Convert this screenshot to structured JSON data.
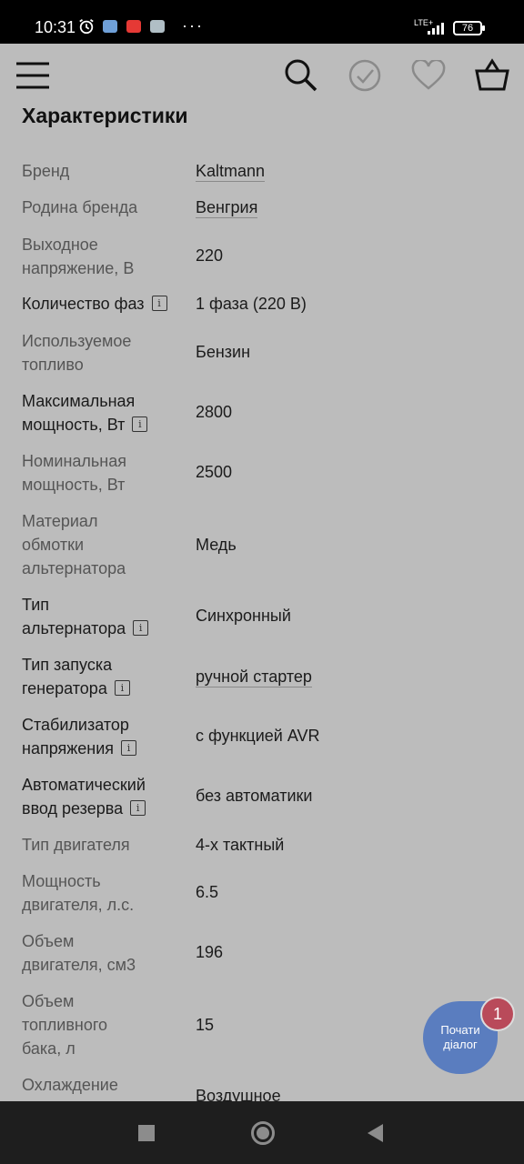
{
  "status_bar": {
    "time": "10:31",
    "more": "···",
    "network": "LTE+",
    "battery": "76"
  },
  "section": {
    "title": "Характеристики"
  },
  "specs": [
    {
      "label": "Бренд",
      "value": "Kaltmann",
      "link": true,
      "info": false
    },
    {
      "label": "Родина бренда",
      "value": "Венгрия",
      "link": true,
      "info": false
    },
    {
      "label": "Выходное напряжение, В",
      "value": "220",
      "link": false,
      "info": false
    },
    {
      "label": "Количество фаз",
      "value": "1 фаза (220 В)",
      "link": false,
      "info": true
    },
    {
      "label": "Используемое топливо",
      "value": "Бензин",
      "link": false,
      "info": false
    },
    {
      "label": "Максимальная мощность, Вт",
      "value": "2800",
      "link": false,
      "info": true
    },
    {
      "label": "Номинальная мощность, Вт",
      "value": "2500",
      "link": false,
      "info": false
    },
    {
      "label": "Материал обмотки альтернатора",
      "value": "Медь",
      "link": false,
      "info": false
    },
    {
      "label": "Тип альтернатора",
      "value": "Синхронный",
      "link": false,
      "info": true
    },
    {
      "label": "Тип запуска генератора",
      "value": "ручной стартер",
      "link": true,
      "info": true
    },
    {
      "label": "Стабилизатор напряжения",
      "value": "с функцией AVR",
      "link": false,
      "info": true
    },
    {
      "label": "Автоматический ввод резерва",
      "value": "без автоматики",
      "link": false,
      "info": true
    },
    {
      "label": "Тип двигателя",
      "value": "4-х тактный",
      "link": false,
      "info": false
    },
    {
      "label": "Мощность двигателя, л.с.",
      "value": "6.5",
      "link": false,
      "info": false
    },
    {
      "label": "Объем двигателя, см3",
      "value": "196",
      "link": false,
      "info": false
    },
    {
      "label": "Объем топливного бака, л",
      "value": "15",
      "link": false,
      "info": false
    },
    {
      "label": "Охлаждение",
      "value": "Воздушное",
      "link": false,
      "info": false
    }
  ],
  "chat": {
    "label_line1": "Почати",
    "label_line2": "діалог",
    "badge": "1",
    "accent": "#5a7dbf"
  },
  "info_glyph": "i",
  "icons": [
    "menu-icon",
    "search-icon",
    "compare-check-icon",
    "heart-icon",
    "basket-icon"
  ]
}
